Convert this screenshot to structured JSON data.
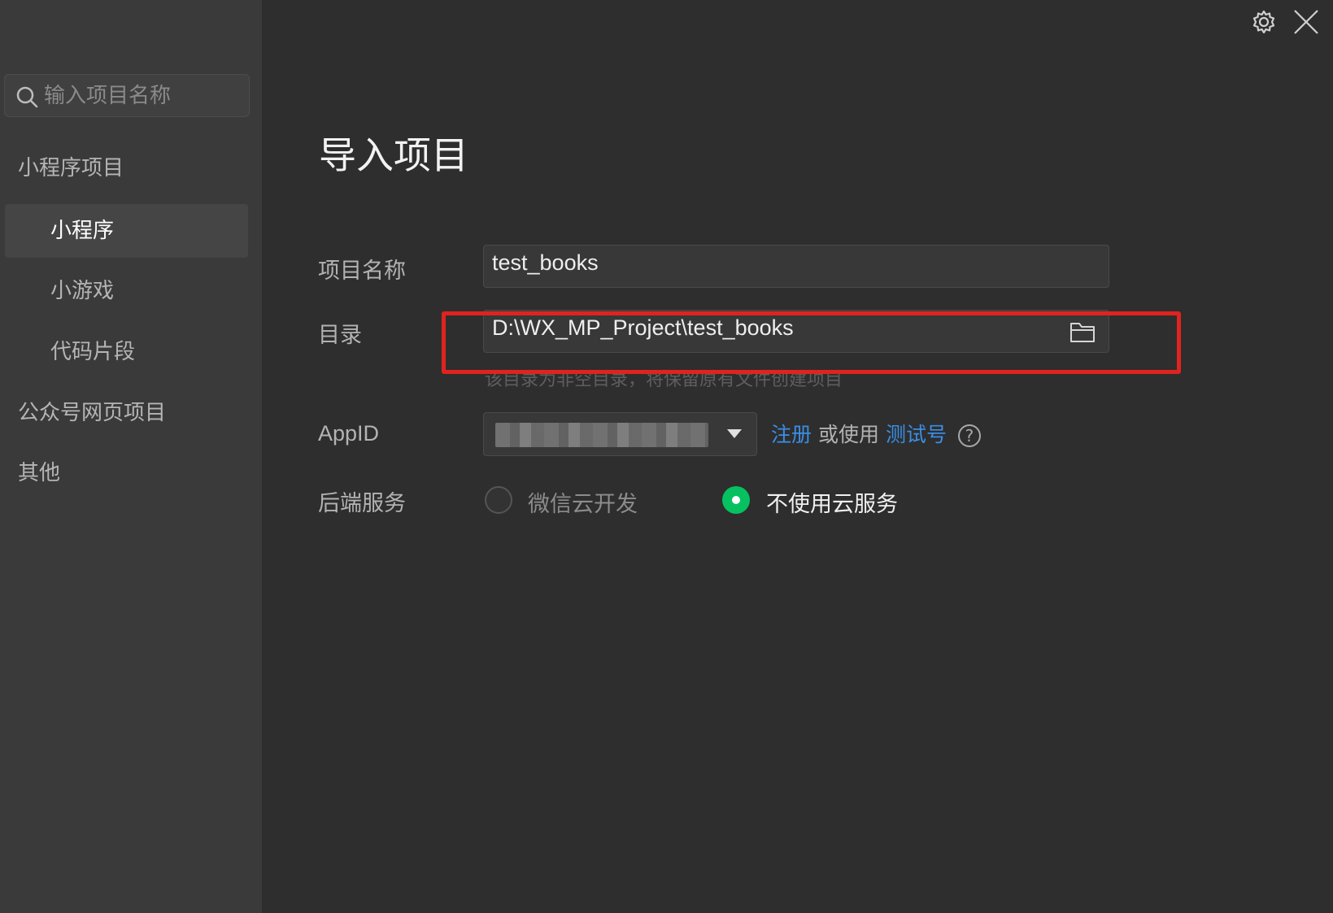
{
  "search": {
    "placeholder": "输入项目名称"
  },
  "sidebar": {
    "groups": [
      {
        "label": "小程序项目"
      },
      {
        "label": "公众号网页项目"
      },
      {
        "label": "其他"
      }
    ],
    "items": [
      {
        "label": "小程序",
        "active": true
      },
      {
        "label": "小游戏"
      },
      {
        "label": "代码片段"
      }
    ]
  },
  "topbar": {
    "settings_icon": "gear-icon",
    "close_icon": "close-icon"
  },
  "form": {
    "title": "导入项目",
    "project_name": {
      "label": "项目名称",
      "value": "test_books"
    },
    "directory": {
      "label": "目录",
      "value": "D:\\WX_MP_Project\\test_books",
      "hint": "该目录为非空目录，将保留原有文件创建项目",
      "icon": "folder-icon"
    },
    "appid": {
      "label": "AppID",
      "register_link": "注册",
      "or_use": "或使用",
      "test_link": "测试号",
      "help_icon": "?"
    },
    "backend": {
      "label": "后端服务",
      "options": [
        {
          "label": "微信云开发",
          "selected": false
        },
        {
          "label": "不使用云服务",
          "selected": true
        }
      ]
    }
  },
  "colors": {
    "accent_green": "#07c160",
    "link_blue": "#3a8ee6",
    "highlight_red": "#e0231f"
  }
}
